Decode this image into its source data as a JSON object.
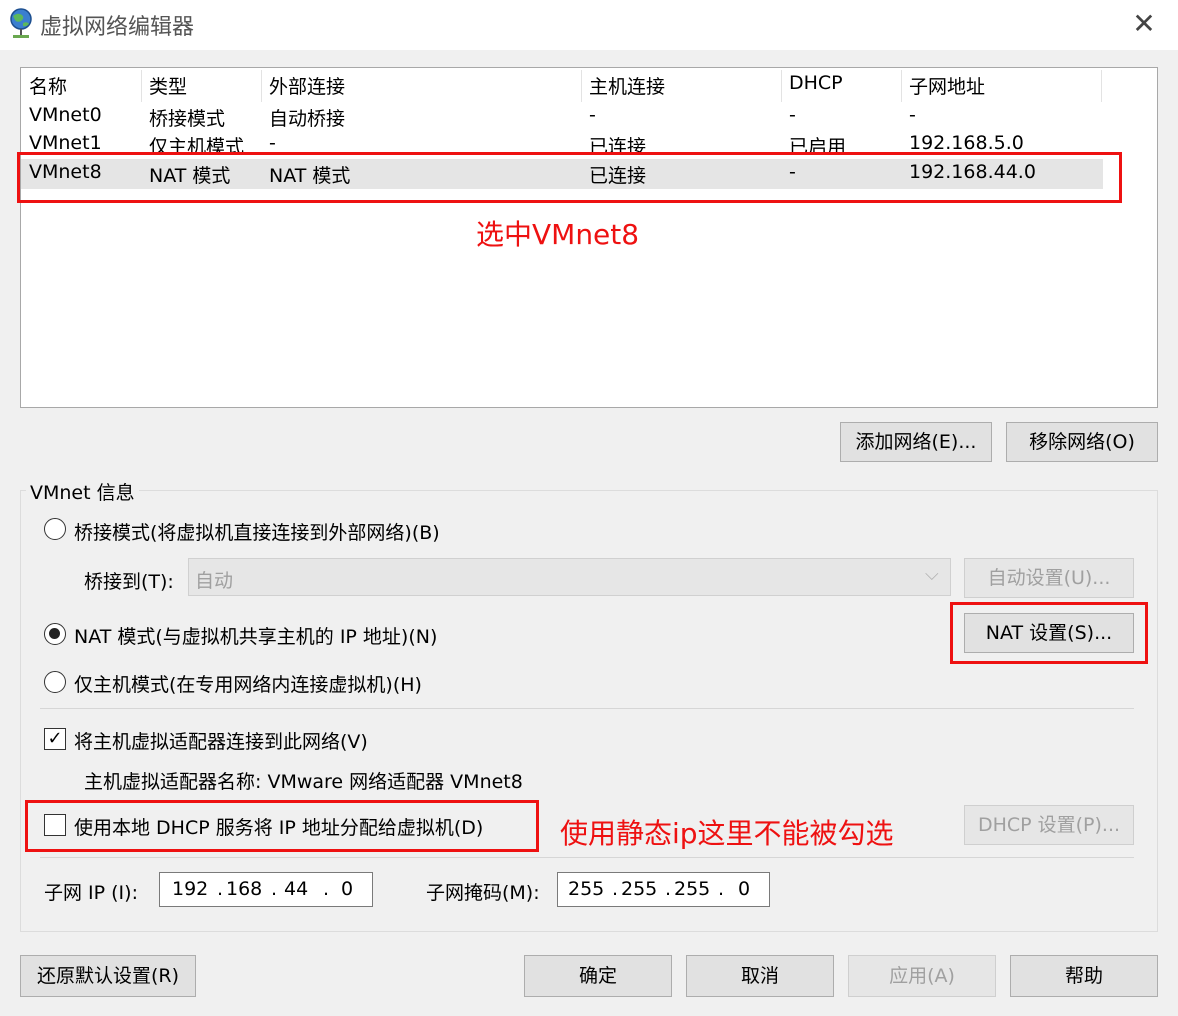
{
  "window": {
    "title": "虚拟网络编辑器",
    "close": "✕"
  },
  "table": {
    "columns": [
      "名称",
      "类型",
      "外部连接",
      "主机连接",
      "DHCP",
      "子网地址"
    ],
    "rows": [
      {
        "name": "VMnet0",
        "type": "桥接模式",
        "external": "自动桥接",
        "host": "-",
        "dhcp": "-",
        "subnet": "-"
      },
      {
        "name": "VMnet1",
        "type": "仅主机模式",
        "external": "-",
        "host": "已连接",
        "dhcp": "已启用",
        "subnet": "192.168.5.0"
      },
      {
        "name": "VMnet8",
        "type": "NAT 模式",
        "external": "NAT 模式",
        "host": "已连接",
        "dhcp": "-",
        "subnet": "192.168.44.0"
      }
    ],
    "selected_row": "VMnet8"
  },
  "buttons": {
    "add_network": "添加网络(E)...",
    "remove_network": "移除网络(O)"
  },
  "info": {
    "group_label": "VMnet 信息",
    "bridge_radio": "桥接模式(将虚拟机直接连接到外部网络)(B)",
    "bridge_to_label": "桥接到(T):",
    "bridge_to_value": "自动",
    "auto_settings": "自动设置(U)...",
    "nat_radio": "NAT 模式(与虚拟机共享主机的 IP 地址)(N)",
    "nat_settings": "NAT 设置(S)...",
    "hostonly_radio": "仅主机模式(在专用网络内连接虚拟机)(H)",
    "connect_adapter": "将主机虚拟适配器连接到此网络(V)",
    "adapter_name": "主机虚拟适配器名称: VMware 网络适配器 VMnet8",
    "use_dhcp": "使用本地 DHCP 服务将 IP 地址分配给虚拟机(D)",
    "dhcp_settings": "DHCP 设置(P)...",
    "subnet_ip_label": "子网 IP (I):",
    "subnet_ip": [
      "192",
      "168",
      "44",
      "0"
    ],
    "subnet_mask_label": "子网掩码(M):",
    "subnet_mask": [
      "255",
      "255",
      "255",
      "0"
    ],
    "selected_mode": "nat",
    "connect_adapter_checked": true,
    "use_dhcp_checked": false
  },
  "footer": {
    "restore": "还原默认设置(R)",
    "ok": "确定",
    "cancel": "取消",
    "apply": "应用(A)",
    "help": "帮助"
  },
  "annotations": {
    "select_vmnet8": "选中VMnet8",
    "static_ip_note": "使用静态ip这里不能被勾选"
  },
  "colors": {
    "annotation": "#ee1111",
    "selected_row": "#e5e5e5",
    "window_bg": "#f0f0f0"
  }
}
